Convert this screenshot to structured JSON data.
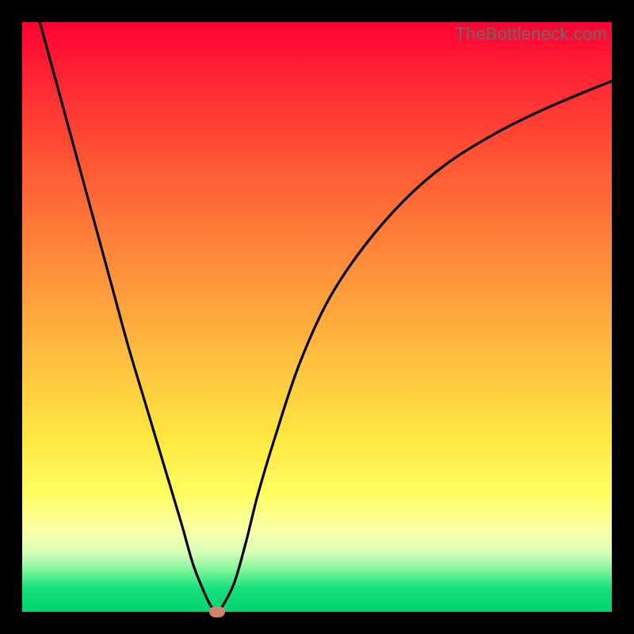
{
  "watermark": "TheBottleneck.com",
  "colors": {
    "frame": "#000000",
    "gradient_top": "#ff0033",
    "gradient_mid": "#ffe640",
    "gradient_bottom": "#00d370",
    "curve": "#000000",
    "marker": "#d18470"
  },
  "chart_data": {
    "type": "line",
    "title": "",
    "xlabel": "",
    "ylabel": "",
    "xlim": [
      0,
      100
    ],
    "ylim": [
      0,
      100
    ],
    "x": [
      3,
      6,
      9,
      12,
      15,
      18,
      21,
      24,
      27,
      29,
      31,
      32,
      33,
      34,
      36,
      38,
      40,
      43,
      47,
      52,
      58,
      65,
      72,
      80,
      88,
      95,
      100
    ],
    "values": [
      100,
      89,
      78,
      67,
      56,
      45,
      35,
      25,
      15,
      8,
      3,
      1,
      0,
      1,
      5,
      12,
      20,
      30,
      42,
      53,
      62,
      70,
      76,
      81,
      85,
      88,
      90
    ],
    "marker": {
      "x": 33,
      "y": 0
    },
    "annotations": []
  }
}
